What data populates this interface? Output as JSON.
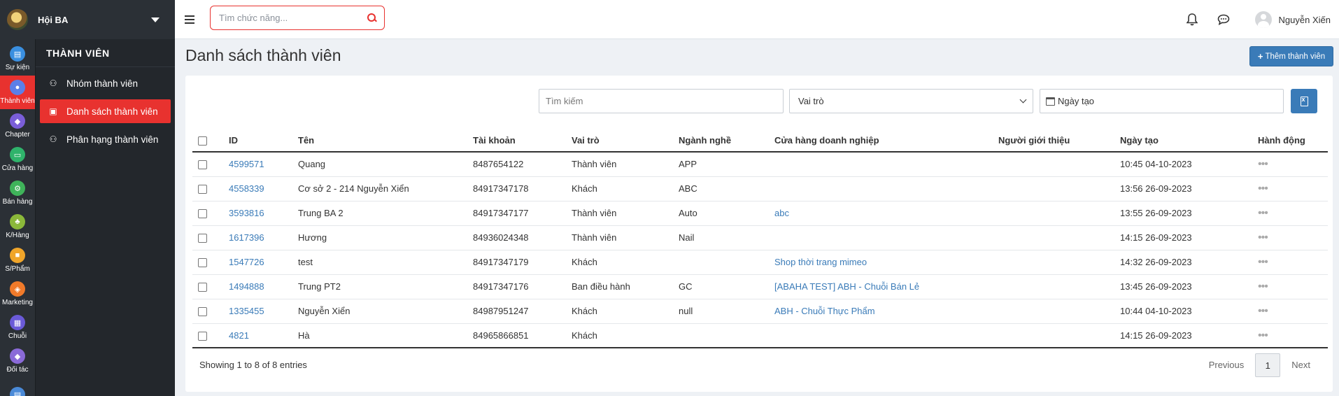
{
  "brand": {
    "name": "Hội BA"
  },
  "rail": [
    {
      "label": "Sự kiện",
      "icon": "calendar-icon",
      "color": "#3a8fe0"
    },
    {
      "label": "Thành viên",
      "icon": "users-icon",
      "color": "#5b7fe8",
      "active": true
    },
    {
      "label": "Chapter",
      "icon": "diamond-icon",
      "color": "#7a5ed8"
    },
    {
      "label": "Cửa hàng",
      "icon": "store-icon",
      "color": "#2fb36b"
    },
    {
      "label": "Bán hàng",
      "icon": "cart-icon",
      "color": "#3fb35a"
    },
    {
      "label": "K/Hàng",
      "icon": "customer-icon",
      "color": "#8bb83a"
    },
    {
      "label": "S/Phẩm",
      "icon": "box-icon",
      "color": "#f0a52a"
    },
    {
      "label": "Marketing",
      "icon": "tag-icon",
      "color": "#f07a2a"
    },
    {
      "label": "Chuỗi",
      "icon": "network-icon",
      "color": "#6a5ad8"
    },
    {
      "label": "Đối tác",
      "icon": "handshake-icon",
      "color": "#8a6ad8"
    },
    {
      "label": "",
      "icon": "document-icon",
      "color": "#4a8ad8"
    }
  ],
  "submenu": {
    "title": "THÀNH VIÊN",
    "items": [
      {
        "label": "Nhóm thành viên",
        "icon": "user-group-icon"
      },
      {
        "label": "Danh sách thành viên",
        "icon": "id-card-icon",
        "active": true
      },
      {
        "label": "Phân hạng thành viên",
        "icon": "users-rank-icon"
      }
    ]
  },
  "topbar": {
    "search_placeholder": "Tìm chức năng...",
    "user_name": "Nguyễn Xiến"
  },
  "page": {
    "title": "Danh sách thành viên",
    "add_button": "Thêm thành viên"
  },
  "filters": {
    "search_placeholder": "Tìm kiếm",
    "role_select": "Vai trò",
    "date_label": "Ngày tạo"
  },
  "table": {
    "headers": [
      "ID",
      "Tên",
      "Tài khoản",
      "Vai trò",
      "Ngành nghề",
      "Cửa hàng doanh nghiệp",
      "Người giới thiệu",
      "Ngày tạo",
      "Hành động"
    ],
    "rows": [
      {
        "id": "4599571",
        "name": "Quang",
        "account": "8487654122",
        "role": "Thành viên",
        "industry": "APP",
        "store": "",
        "referrer": "",
        "created": "10:45 04-10-2023"
      },
      {
        "id": "4558339",
        "name": "Cơ sở 2 - 214 Nguyễn Xiển",
        "account": "84917347178",
        "role": "Khách",
        "industry": "ABC",
        "store": "",
        "referrer": "",
        "created": "13:56 26-09-2023"
      },
      {
        "id": "3593816",
        "name": "Trung BA 2",
        "account": "84917347177",
        "role": "Thành viên",
        "industry": "Auto",
        "store": "abc",
        "referrer": "",
        "created": "13:55 26-09-2023"
      },
      {
        "id": "1617396",
        "name": "Hương",
        "account": "84936024348",
        "role": "Thành viên",
        "industry": "Nail",
        "store": "",
        "referrer": "",
        "created": "14:15 26-09-2023"
      },
      {
        "id": "1547726",
        "name": "test",
        "account": "84917347179",
        "role": "Khách",
        "industry": "",
        "store": "Shop thời trang mimeo",
        "referrer": "",
        "created": "14:32 26-09-2023"
      },
      {
        "id": "1494888",
        "name": "Trung PT2",
        "account": "84917347176",
        "role": "Ban điều hành",
        "industry": "GC",
        "store": "[ABAHA TEST] ABH - Chuỗi Bán Lẻ",
        "referrer": "",
        "created": "13:45 26-09-2023"
      },
      {
        "id": "1335455",
        "name": "Nguyễn Xiển",
        "account": "84987951247",
        "role": "Khách",
        "industry": "null",
        "store": "ABH - Chuỗi Thực Phẩm",
        "referrer": "",
        "created": "10:44 04-10-2023"
      },
      {
        "id": "4821",
        "name": "Hà",
        "account": "84965866851",
        "role": "Khách",
        "industry": "",
        "store": "",
        "referrer": "",
        "created": "14:15 26-09-2023"
      }
    ]
  },
  "footer": {
    "info": "Showing 1 to 8 of 8 entries",
    "previous": "Previous",
    "current_page": "1",
    "next": "Next"
  },
  "colors": {
    "accent_red": "#e8322f",
    "primary_blue": "#3a7bb8",
    "sidebar_dark": "#2b3036"
  }
}
